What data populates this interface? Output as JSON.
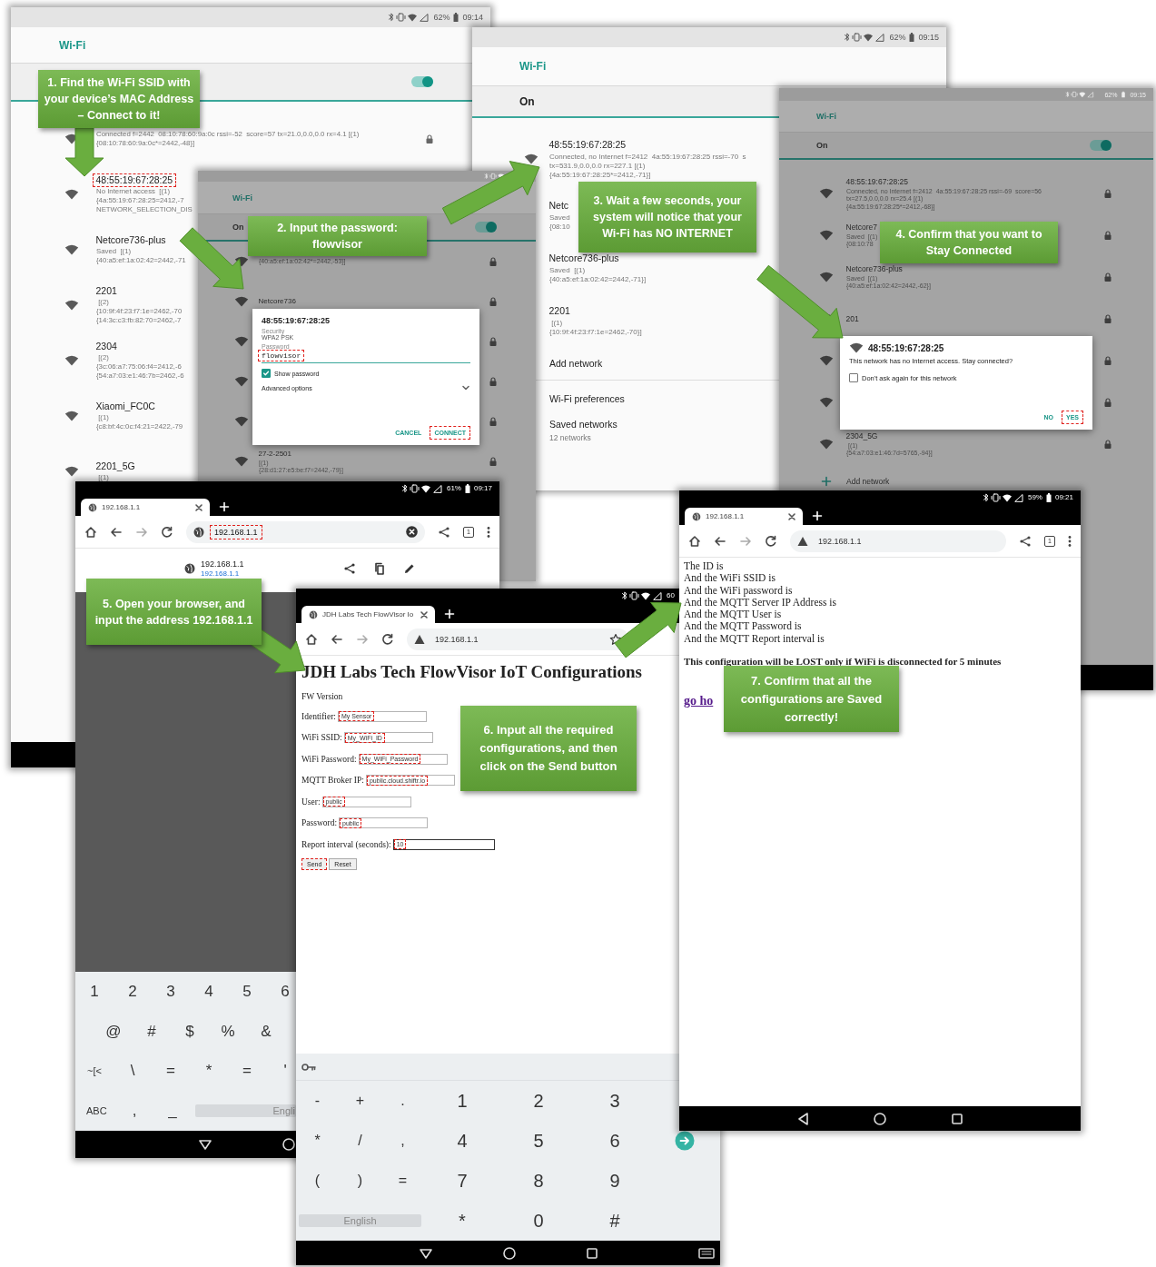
{
  "wifi_screens": [
    {
      "dimmed": false,
      "battery": "62%",
      "time": "09:14",
      "title": "Wi-Fi",
      "switch": {
        "on": true
      },
      "networks": [
        {
          "details": [
            "Connected f=2442  08:10:78:60:9a:0c rssi=-52  score=57 tx=21.0,0.0,0.0 rx=4.1 [(1)",
            "{08:10:78:60:9a:0c*=2442,-48}]"
          ],
          "locked": true
        },
        {
          "name": "48:55:19:67:28:25",
          "details": [
            "No Internet access  [(1)",
            "{4a:55:19:67:28:25=2412,-7",
            "NETWORK_SELECTION_DIS"
          ],
          "highlighted": true
        },
        {
          "name": "Netcore736-plus",
          "details": [
            "Saved  [(1)",
            "{40:a5:ef:1a:02:42=2442,-71"
          ],
          "highlighted": false
        },
        {
          "name": "2201",
          "details": [
            " [(2)",
            "{10:9f:4f:23:f7:1e=2462,-70",
            "{14:3c:c3:fb:82:70=2462,-7"
          ],
          "highlighted": false
        },
        {
          "name": "2304",
          "details": [
            " [(2)",
            "{3c:06:a7:75:06:f4=2412,-6",
            "{54:a7:03:e1:46:7b=2462,-6"
          ],
          "highlighted": false
        },
        {
          "name": "Xiaomi_FC0C",
          "details": [
            " [(1)",
            "{c8:bf:4c:0c:f4:21=2422,-79"
          ],
          "highlighted": false
        },
        {
          "name": "2201_5G",
          "details": [
            " [(1)"
          ],
          "highlighted": false
        }
      ]
    },
    {
      "dimmed": true,
      "title": "Wi-Fi",
      "switch": {
        "label": "On",
        "on": true
      },
      "networks": [
        {
          "details": [
            "{40:a5:ef:1a:02:42*=2442,-53}]"
          ],
          "locked": true
        },
        {
          "name": "Netcore736",
          "locked": true,
          "highlighted": false
        },
        {
          "locked": true
        },
        {
          "locked": true
        },
        {
          "locked": true
        },
        {
          "name": "27-2-2501",
          "details": [
            "[(1)",
            "{28:d1:27:e5:be:f7=2442,-79}]"
          ],
          "locked": true,
          "highlighted": false
        }
      ],
      "dialog": {
        "kind": "password",
        "title": "48:55:19:67:28:25",
        "fields": [
          {
            "label": "Security",
            "value": "WPA2 PSK"
          }
        ],
        "password": {
          "label": "Password",
          "value": "flowvisor",
          "highlighted": true
        },
        "checkbox": {
          "label": "Show password",
          "checked": true
        },
        "expander": "Advanced options",
        "buttons": [
          {
            "label": "CANCEL",
            "highlighted": false
          },
          {
            "label": "CONNECT",
            "highlighted": true
          }
        ]
      }
    },
    {
      "dimmed": false,
      "battery": "62%",
      "time": "09:15",
      "title": "Wi-Fi",
      "switch": {
        "label": "On"
      },
      "networks": [
        {
          "name": "48:55:19:67:28:25",
          "details": [
            "Connected, no Internet f=2412  4a:55:19:67:28:25 rssi=-70  s",
            "tx=531.9,0.0,0.0 rx=227.1 [(1)",
            "{4a:55:19:67:28:25*=2412,-71}]"
          ],
          "highlighted": false
        },
        {
          "name": "Netc",
          "details": [
            "Saved",
            "{08:10"
          ],
          "highlighted": false
        },
        {
          "name": "Netcore736-plus",
          "details": [
            "Saved  [(1)",
            "{40:a5:ef:1a:02:42=2442,-71}]"
          ],
          "highlighted": false
        },
        {
          "name": "2201",
          "details": [
            " [(1)",
            "{10:9f:4f:23:f7:1e=2462,-70}]"
          ],
          "highlighted": false
        }
      ],
      "add_network": "Add network",
      "links": [
        {
          "title": "Wi-Fi preferences"
        },
        {
          "title": "Saved networks",
          "subtitle": "12 networks"
        }
      ]
    },
    {
      "dimmed": true,
      "battery": "62%",
      "time": "09:15",
      "title": "Wi-Fi",
      "switch": {
        "label": "On",
        "on": true
      },
      "networks": [
        {
          "name": "48:55:19:67:28:25",
          "details": [
            "Connected, no Internet f=2412  4a:55:19:67:28:25 rssi=-69  score=56",
            "tx=27.5,0.0,0.0 rx=25.4 [(1)",
            "{4a:55:19:67:28:25*=2412,-68}]"
          ],
          "locked": true,
          "highlighted": false
        },
        {
          "name": "Netcore7",
          "details": [
            "Saved  [(1)",
            "{08:10:78"
          ],
          "locked": true,
          "highlighted": false
        },
        {
          "name": "Netcore736-plus",
          "details": [
            "Saved  [(1)",
            "{40:a5:ef:1a:02:42=2442,-62}]"
          ],
          "locked": true,
          "highlighted": false
        },
        {
          "name": "201",
          "locked": true,
          "highlighted": false
        },
        {
          "locked": true
        },
        {
          "locked": true
        },
        {
          "name": "2304_5G",
          "details": [
            " [(1)",
            "{54:a7:03:e1:46:7d=5765,-94}]"
          ],
          "locked": true,
          "highlighted": false
        }
      ],
      "add_network": "Add network",
      "dialog": {
        "kind": "no_internet",
        "title": "48:55:19:67:28:25",
        "message": "This network has no Internet access. Stay connected?",
        "checkbox": {
          "label": "Don't ask again for this network",
          "checked": false
        },
        "buttons": [
          {
            "label": "NO",
            "highlighted": false
          },
          {
            "label": "YES",
            "highlighted": true
          }
        ]
      }
    }
  ],
  "browser_screens": [
    {
      "battery": "61%",
      "time": "09:17",
      "tab_title": "192.168.1.1",
      "url": "192.168.1.1",
      "url_highlighted": true,
      "url_editing": true,
      "keyboard_open": true,
      "actions": [
        {
          "kind": "clear"
        },
        {
          "kind": "share"
        },
        {
          "kind": "tabs",
          "label": "1"
        },
        {
          "kind": "menu"
        }
      ],
      "page": {
        "kind": "suggestion",
        "title": "192.168.1.1",
        "url": "192.168.1.1"
      },
      "keyboard": {
        "kind": "symbols",
        "rows": [
          [
            "1",
            "2",
            "3",
            "4",
            "5",
            "6"
          ],
          [
            "@",
            "#",
            "$",
            "%",
            "&"
          ],
          [
            "~[<",
            "\\",
            "=",
            "*",
            "=",
            "'"
          ],
          [
            "ABC",
            ",",
            "_"
          ]
        ],
        "space_label": "Engli"
      }
    },
    {
      "battery": "60",
      "tab_title": "JDH Labs Tech FlowVisor Io",
      "url": "192.168.1.1",
      "url_highlighted": false,
      "url_editing": false,
      "keyboard_open": true,
      "actions": [
        {
          "kind": "star"
        }
      ],
      "page": {
        "kind": "form",
        "heading": "JDH Labs Tech FlowVisor IoT Configurations",
        "version_label": "FW Version",
        "fields": [
          {
            "label": "Identifier:",
            "value": "My Sensor",
            "highlighted": true,
            "focused": false
          },
          {
            "label": "WiFi SSID:",
            "value": "My_WiFi_ID",
            "highlighted": true,
            "focused": false
          },
          {
            "label": "WiFi Password:",
            "value": "My_WiFi_Password",
            "highlighted": true,
            "focused": false
          },
          {
            "label": "MQTT Broker IP:",
            "value": "public.cloud.shiftr.io",
            "highlighted": true,
            "focused": false
          },
          {
            "label": "User:",
            "value": "public",
            "highlighted": true,
            "focused": false
          },
          {
            "label": "Password:",
            "value": "public",
            "highlighted": true,
            "focused": false
          },
          {
            "label": "Report interval (seconds):",
            "value": "10",
            "highlighted": true,
            "focused": true
          }
        ],
        "buttons": [
          {
            "label": "Send",
            "highlighted": true
          },
          {
            "label": "Reset",
            "highlighted": false
          }
        ]
      },
      "keyboard": {
        "kind": "numeric",
        "rows": [
          [
            "-",
            "+",
            ".",
            "1",
            "2",
            "3"
          ],
          [
            "*",
            "/",
            ",",
            "4",
            "5",
            "6"
          ],
          [
            "(",
            ")",
            "=",
            "7",
            "8",
            "9"
          ],
          [
            "",
            "",
            "",
            "*",
            "0",
            "#"
          ]
        ],
        "space_label": "English"
      }
    },
    {
      "battery": "59%",
      "time": "09:21",
      "tab_title": "192.168.1.1",
      "url": "192.168.1.1",
      "url_highlighted": false,
      "url_editing": false,
      "keyboard_open": false,
      "actions": [
        {
          "kind": "share"
        },
        {
          "kind": "tabs",
          "label": "1"
        },
        {
          "kind": "menu"
        }
      ],
      "page": {
        "kind": "result",
        "lines": [
          "The ID is",
          "And the WiFi SSID is",
          "And the WiFi password is",
          "And the MQTT Server IP Address is",
          "And the MQTT User is",
          "And the MQTT Password is",
          "And the MQTT Report interval is"
        ],
        "notice": "This configuration will be LOST only if WiFi is disconnected for 5 minutes",
        "link": "go ho"
      }
    }
  ],
  "callouts": [
    {
      "text": "1. Find the Wi-Fi SSID with your device’s MAC Address – Connect to it!"
    },
    {
      "text": "2. Input the password: flowvisor"
    },
    {
      "text": "3. Wait a few seconds, your system will notice that your Wi-Fi has NO INTERNET"
    },
    {
      "text": "4. Confirm that you want to Stay Connected"
    },
    {
      "text": "5. Open your browser, and input the address 192.168.1.1"
    },
    {
      "text": "6. Input all the required configurations, and then click on the Send button"
    },
    {
      "text": "7. Confirm that all the configurations are Saved correctly!"
    }
  ]
}
